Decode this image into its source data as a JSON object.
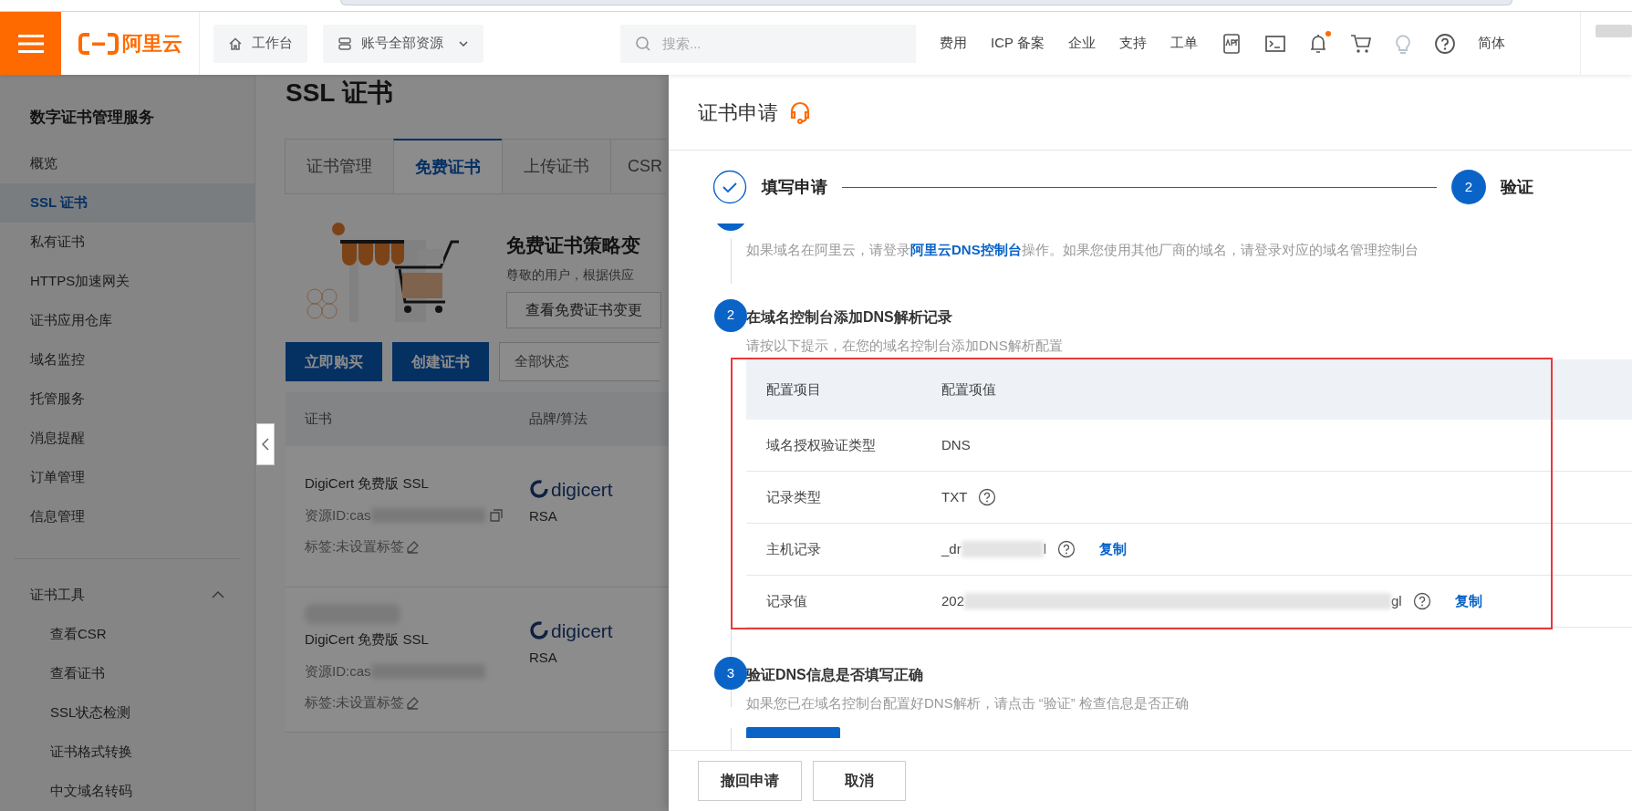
{
  "header": {
    "logo": "阿里云",
    "workbench": "工作台",
    "resources": "账号全部资源",
    "search": {
      "placeholder": "搜索..."
    },
    "nav_links": [
      "费用",
      "ICP 备案",
      "企业",
      "支持",
      "工单"
    ],
    "notifications_unread": true,
    "language": "简体"
  },
  "sidebar": {
    "title": "数字证书管理服务",
    "items": [
      {
        "label": "概览",
        "selected": false
      },
      {
        "label": "SSL 证书",
        "selected": true
      },
      {
        "label": "私有证书",
        "selected": false
      },
      {
        "label": "HTTPS加速网关",
        "selected": false
      },
      {
        "label": "证书应用仓库",
        "selected": false
      },
      {
        "label": "域名监控",
        "selected": false
      },
      {
        "label": "托管服务",
        "selected": false
      },
      {
        "label": "消息提醒",
        "selected": false
      },
      {
        "label": "订单管理",
        "selected": false
      },
      {
        "label": "信息管理",
        "selected": false
      }
    ],
    "group": {
      "label": "证书工具",
      "expanded": true,
      "children": [
        {
          "label": "查看CSR"
        },
        {
          "label": "查看证书"
        },
        {
          "label": "SSL状态检测"
        },
        {
          "label": "证书格式转换"
        },
        {
          "label": "中文域名转码"
        }
      ]
    }
  },
  "page": {
    "title": "SSL 证书",
    "tabs": [
      {
        "label": "证书管理",
        "selected": false
      },
      {
        "label": "免费证书",
        "selected": true
      },
      {
        "label": "上传证书",
        "selected": false
      },
      {
        "label": "CSR",
        "selected": false
      }
    ],
    "notice": {
      "title": "免费证书策略变",
      "text": "尊敬的用户，根据供应",
      "button": "查看免费证书变更"
    },
    "actions": [
      "立即购买",
      "创建证书"
    ],
    "status_filter": "全部状态",
    "table": {
      "columns": [
        "证书",
        "品牌/算法"
      ],
      "rows": [
        {
          "product": "DigiCert 免费版 SSL",
          "resource_id": "资源ID:cas",
          "copyable": true,
          "tag": "标签:未设置标签",
          "brand": "digicert",
          "algorithm": "RSA"
        },
        {
          "product": "DigiCert 免费版 SSL",
          "resource_id": "资源ID:cas",
          "copyable": false,
          "tag": "标签:未设置标签",
          "brand": "digicert",
          "algorithm": "RSA"
        }
      ]
    }
  },
  "drawer": {
    "title": "证书申请",
    "steps": [
      {
        "label": "填写申请",
        "completed": true
      },
      {
        "number": "2",
        "label": "验证",
        "completed": false
      }
    ],
    "step1_tail": {
      "before": "如果域名在阿里云，请登录",
      "link": "阿里云DNS控制台",
      "after": "操作。如果您使用其他厂商的域名，请登录对应的域名管理控制台"
    },
    "step2": {
      "number": "2",
      "title": "在域名控制台添加DNS解析记录",
      "desc": "请按以下提示，在您的域名控制台添加DNS解析配置"
    },
    "records": {
      "highlighted": true,
      "columns": [
        "配置项目",
        "配置项值"
      ],
      "rows": [
        {
          "item": "域名授权验证类型",
          "value": "DNS",
          "masked": false,
          "help": false
        },
        {
          "item": "记录类型",
          "value": "TXT",
          "masked": false,
          "help": true
        },
        {
          "item": "主机记录",
          "value": "_dr",
          "value_end": "l",
          "masked": true,
          "help": true,
          "copy": "复制"
        },
        {
          "item": "记录值",
          "value": "202",
          "value_end": "gl",
          "masked": true,
          "help": true,
          "copy": "复制"
        }
      ]
    },
    "step3": {
      "number": "3",
      "title": "验证DNS信息是否填写正确",
      "desc": "如果您已在域名控制台配置好DNS解析，请点击 “验证” 检查信息是否正确"
    },
    "footer_buttons": [
      "撤回申请",
      "取消"
    ]
  }
}
